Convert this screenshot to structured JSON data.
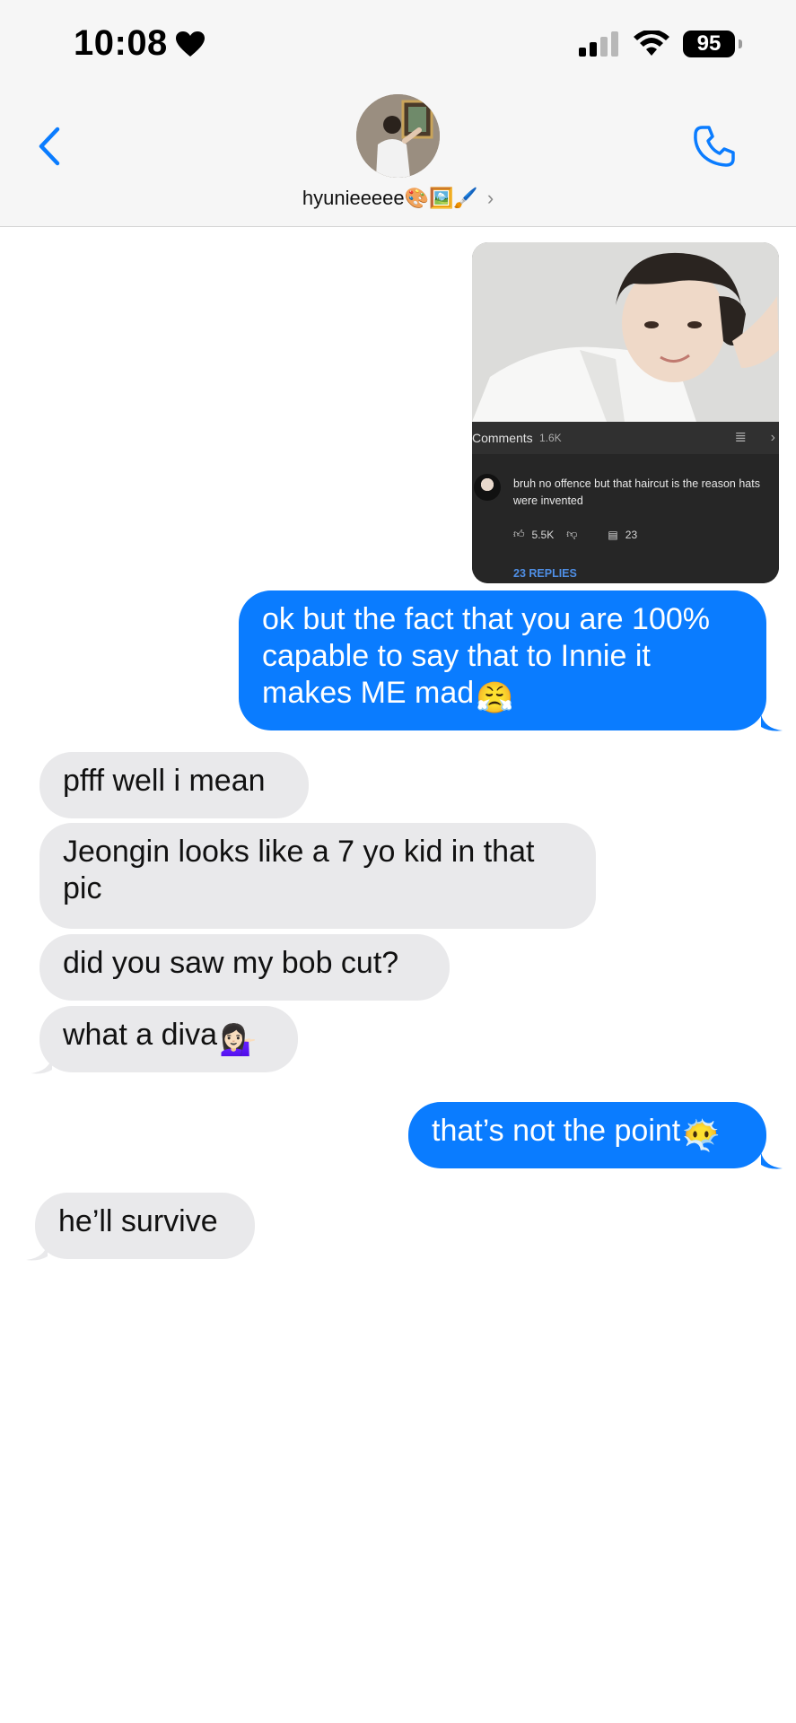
{
  "status_bar": {
    "time": "10:08",
    "battery": "95"
  },
  "contact": {
    "name": "hyunieeeee🎨🖼️🖌️"
  },
  "shared_image": {
    "comments_label": "Comments",
    "comments_count": "1.6K",
    "comment_text": "bruh no offence but that haircut is the reason hats were invented",
    "likes": "5.5K",
    "reply_count": "23",
    "replies_link": "23 REPLIES"
  },
  "messages": [
    {
      "from": "me",
      "text": "ok but the fact that you are 100% capable to say that to Innie it makes ME mad",
      "emoji": "😤"
    },
    {
      "from": "them",
      "text": "pfff well i mean"
    },
    {
      "from": "them",
      "text": "Jeongin looks like a 7 yo kid in that pic"
    },
    {
      "from": "them",
      "text": "did you saw my bob cut?"
    },
    {
      "from": "them",
      "text": "what a diva",
      "emoji": "💁🏻‍♀️"
    },
    {
      "from": "me",
      "text": "that’s not the point",
      "emoji": "😶‍🌫️"
    },
    {
      "from": "them",
      "text": "he’ll survive"
    }
  ],
  "colors": {
    "sent_bubble": "#0a7cff",
    "received_bubble": "#e9e9eb",
    "accent": "#0a7cff"
  },
  "icons": {
    "back": "chevron-left-icon",
    "call": "phone-icon",
    "signal": "signal-bars-icon",
    "wifi": "wifi-icon",
    "battery": "battery-icon"
  }
}
